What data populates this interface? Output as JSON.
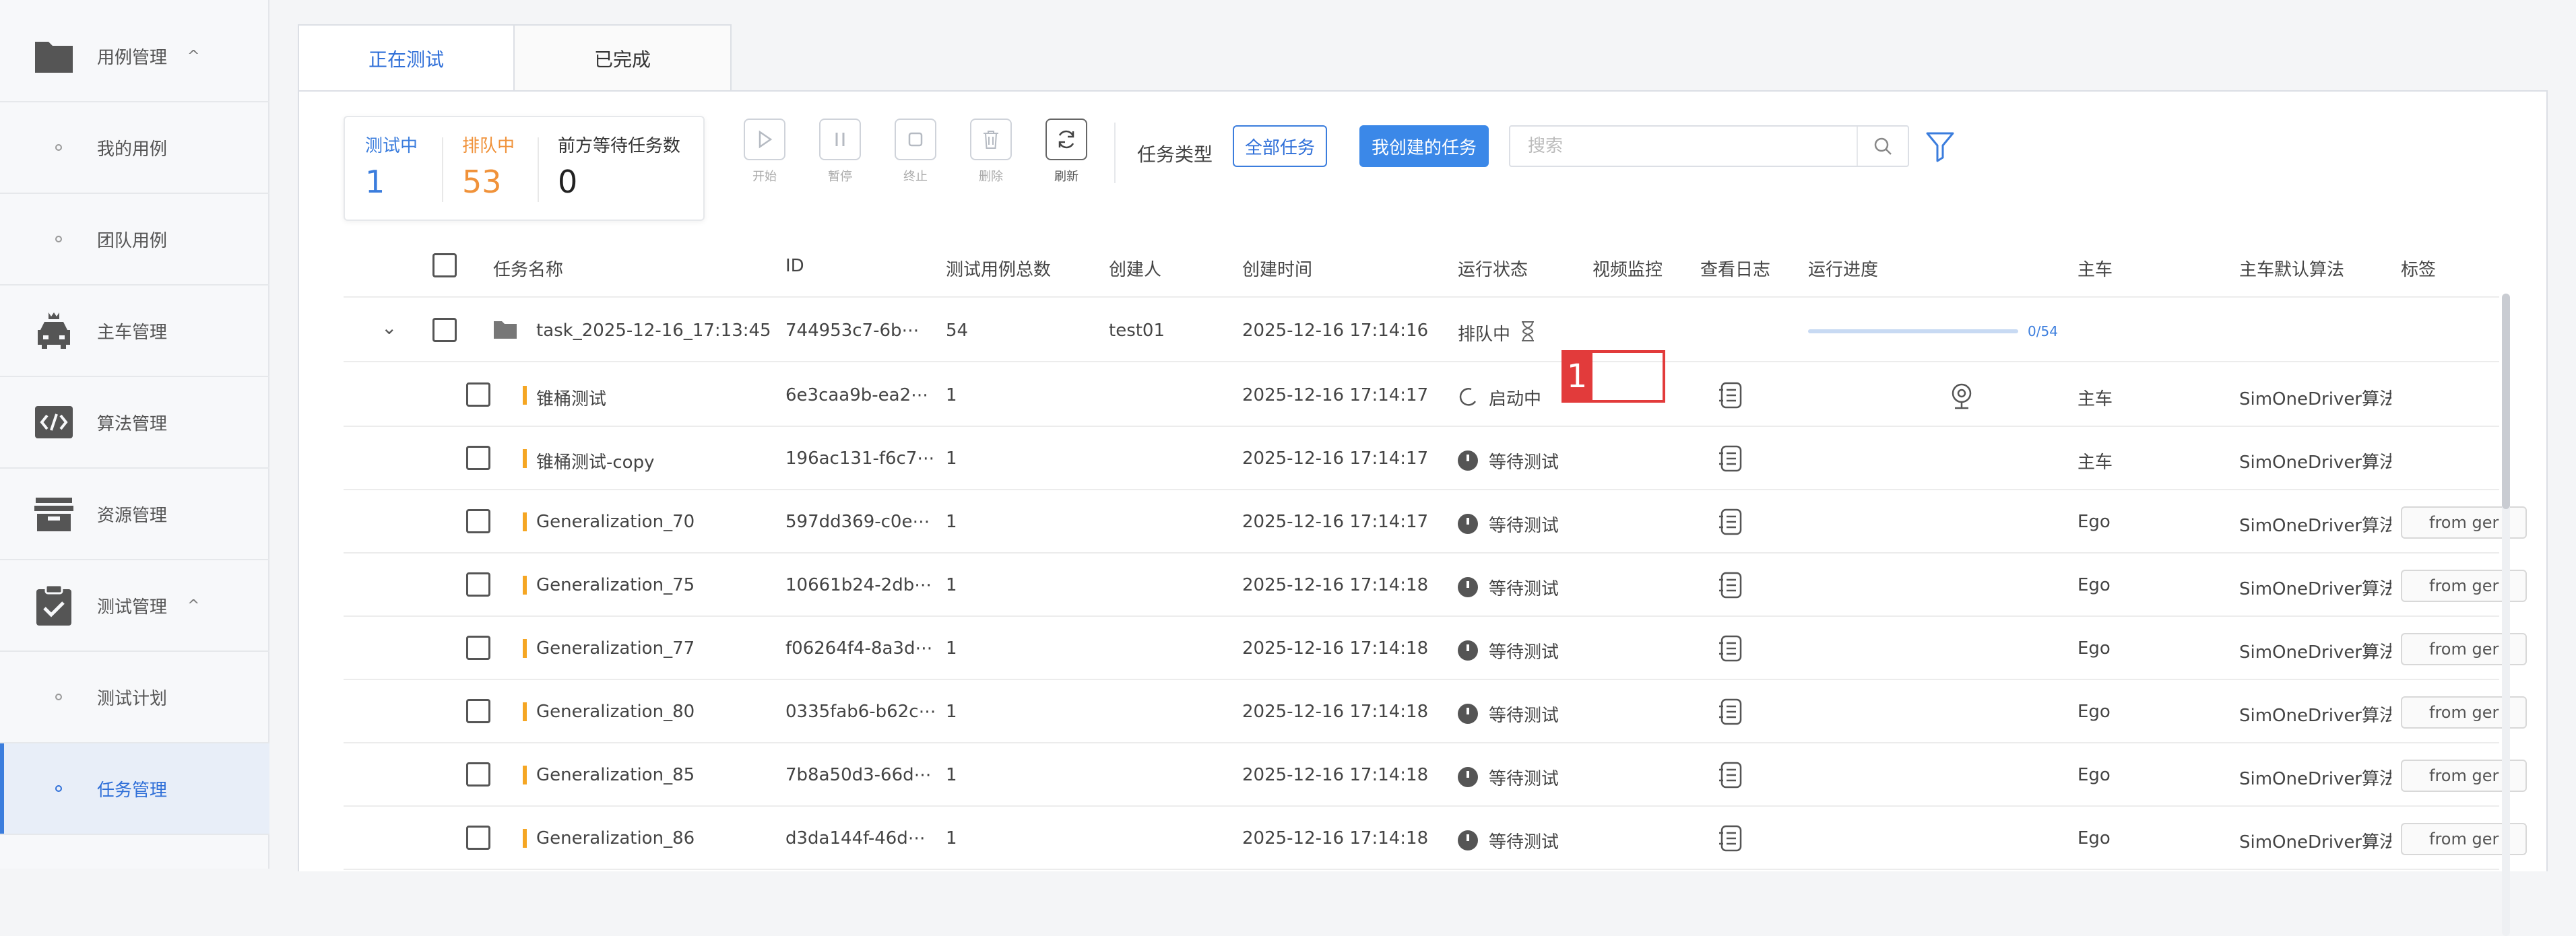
{
  "sidebar": {
    "items": [
      {
        "label": "用例管理",
        "icon": "folder-icon",
        "expandable": true
      },
      {
        "label": "我的用例",
        "sub": true
      },
      {
        "label": "团队用例",
        "sub": true
      },
      {
        "label": "主车管理",
        "icon": "car-icon"
      },
      {
        "label": "算法管理",
        "icon": "code-icon"
      },
      {
        "label": "资源管理",
        "icon": "box-icon"
      },
      {
        "label": "测试管理",
        "icon": "clipboard-check-icon",
        "expandable": true
      },
      {
        "label": "测试计划",
        "sub": true
      },
      {
        "label": "任务管理",
        "sub": true,
        "active": true
      }
    ],
    "chevron": "^"
  },
  "tabs": [
    {
      "label": "正在测试",
      "active": true
    },
    {
      "label": "已完成"
    }
  ],
  "stats": {
    "testing_label": "测试中",
    "testing_value": "1",
    "queued_label": "排队中",
    "queued_value": "53",
    "waiting_label": "前方等待任务数",
    "waiting_value": "0"
  },
  "toolbar": {
    "start": "开始",
    "pause": "暂停",
    "stop": "终止",
    "delete": "删除",
    "refresh": "刷新",
    "task_type_label": "任务类型",
    "all_tasks": "全部任务",
    "my_tasks": "我创建的任务",
    "search_placeholder": "搜索"
  },
  "colors": {
    "accent": "#3b7ddd",
    "queued": "#f0923a",
    "highlight": "#e23b3b",
    "name_marker": "#f5a623"
  },
  "table": {
    "headers": {
      "name": "任务名称",
      "id": "ID",
      "total": "测试用例总数",
      "creator": "创建人",
      "created": "创建时间",
      "status": "运行状态",
      "video": "视频监控",
      "log": "查看日志",
      "progress": "运行进度",
      "car": "主车",
      "algo": "主车默认算法",
      "tag": "标签"
    },
    "group": {
      "name": "task_2025-12-16_17:13:45",
      "id": "744953c7-6b⋯",
      "total": "54",
      "creator": "test01",
      "created": "2025-12-16 17:14:16",
      "status": "排队中",
      "progress_text": "0/54",
      "progress_value": 0
    },
    "rows": [
      {
        "name": "锥桶测试",
        "id": "6e3caa9b-ea2⋯",
        "total": "1",
        "created": "2025-12-16 17:14:17",
        "status": "启动中",
        "status_icon": "spinner-icon",
        "car": "主车",
        "algo": "SimOneDriver算法",
        "tag": ""
      },
      {
        "name": "锥桶测试-copy",
        "id": "196ac131-f6c7⋯",
        "total": "1",
        "created": "2025-12-16 17:14:17",
        "status": "等待测试",
        "status_icon": "clock-icon",
        "car": "主车",
        "algo": "SimOneDriver算法",
        "tag": ""
      },
      {
        "name": "Generalization_70",
        "id": "597dd369-c0e⋯",
        "total": "1",
        "created": "2025-12-16 17:14:17",
        "status": "等待测试",
        "status_icon": "clock-icon",
        "car": "Ego",
        "algo": "SimOneDriver算法",
        "tag": "from ger"
      },
      {
        "name": "Generalization_75",
        "id": "10661b24-2db⋯",
        "total": "1",
        "created": "2025-12-16 17:14:18",
        "status": "等待测试",
        "status_icon": "clock-icon",
        "car": "Ego",
        "algo": "SimOneDriver算法",
        "tag": "from ger"
      },
      {
        "name": "Generalization_77",
        "id": "f06264f4-8a3d⋯",
        "total": "1",
        "created": "2025-12-16 17:14:18",
        "status": "等待测试",
        "status_icon": "clock-icon",
        "car": "Ego",
        "algo": "SimOneDriver算法",
        "tag": "from ger"
      },
      {
        "name": "Generalization_80",
        "id": "0335fab6-b62c⋯",
        "total": "1",
        "created": "2025-12-16 17:14:18",
        "status": "等待测试",
        "status_icon": "clock-icon",
        "car": "Ego",
        "algo": "SimOneDriver算法",
        "tag": "from ger"
      },
      {
        "name": "Generalization_85",
        "id": "7b8a50d3-66d⋯",
        "total": "1",
        "created": "2025-12-16 17:14:18",
        "status": "等待测试",
        "status_icon": "clock-icon",
        "car": "Ego",
        "algo": "SimOneDriver算法",
        "tag": "from ger"
      },
      {
        "name": "Generalization_86",
        "id": "d3da144f-46d⋯",
        "total": "1",
        "created": "2025-12-16 17:14:18",
        "status": "等待测试",
        "status_icon": "clock-icon",
        "car": "Ego",
        "algo": "SimOneDriver算法",
        "tag": "from ger"
      }
    ]
  },
  "annotation": {
    "badge": "1"
  }
}
